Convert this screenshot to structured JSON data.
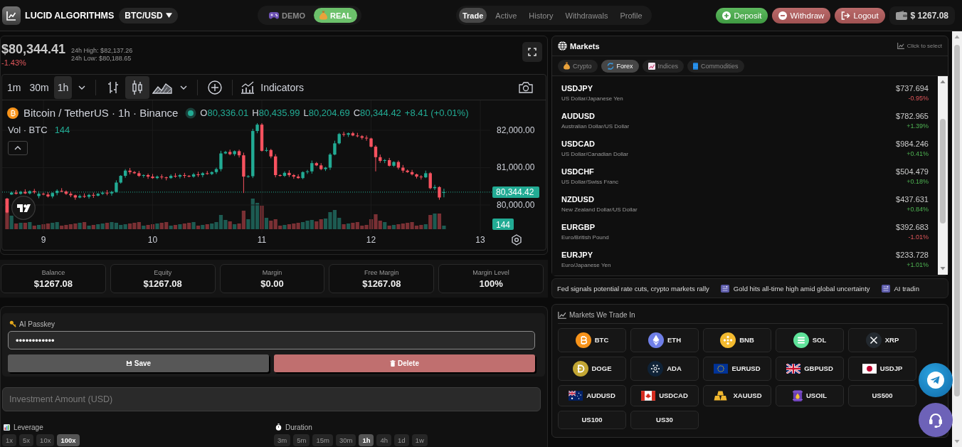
{
  "header": {
    "brand": "LUCID ALGORITHMS",
    "pair": "BTC/USD",
    "modes": [
      {
        "label": "DEMO",
        "kind": "demo",
        "selected": false
      },
      {
        "label": "REAL",
        "kind": "real",
        "selected": true
      }
    ],
    "nav": [
      {
        "label": "Trade",
        "selected": true
      },
      {
        "label": "Active",
        "selected": false
      },
      {
        "label": "History",
        "selected": false
      },
      {
        "label": "Withdrawals",
        "selected": false
      },
      {
        "label": "Profile",
        "selected": false
      }
    ],
    "actions": [
      {
        "label": "Deposit",
        "kind": "deposit"
      },
      {
        "label": "Withdraw",
        "kind": "withdraw"
      },
      {
        "label": "Logout",
        "kind": "logout"
      }
    ],
    "balance": "$ 1267.08"
  },
  "price_summary": {
    "price": "$80,344.41",
    "change": "-1.43%",
    "rising": false,
    "high": "24h High: $82,137.26",
    "low": "24h Low: $80,188.65"
  },
  "chart_widget": {
    "intervals": [
      {
        "label": "1m",
        "selected": false
      },
      {
        "label": "30m",
        "selected": false
      },
      {
        "label": "1h",
        "selected": true
      }
    ],
    "styles": [
      {
        "kind": "bars",
        "selected": false
      },
      {
        "kind": "candles",
        "selected": true
      },
      {
        "kind": "area",
        "selected": false
      }
    ],
    "indicators": "Indicators",
    "symbol": "Bitcoin / TetherUS · 1h · Binance",
    "ohlc": [
      {
        "label": "O",
        "value": "80,336.01"
      },
      {
        "label": "H",
        "value": "80,435.99"
      },
      {
        "label": "L",
        "value": "80,204.69"
      },
      {
        "label": "C",
        "value": "80,344.42"
      }
    ],
    "change": "+8.41 (+0.01%)",
    "volume_label": "Vol · BTC",
    "volume_value": "144",
    "last_volume": "144",
    "chart_data": {
      "type": "candlestick",
      "x": [
        8.667,
        8.708,
        8.75,
        8.792,
        8.833,
        8.875,
        8.917,
        8.958,
        9,
        9.042,
        9.083,
        9.125,
        9.167,
        9.208,
        9.25,
        9.292,
        9.333,
        9.375,
        9.417,
        9.458,
        9.5,
        9.542,
        9.583,
        9.625,
        9.667,
        9.708,
        9.75,
        9.792,
        9.833,
        9.875,
        9.917,
        9.958,
        10,
        10.042,
        10.083,
        10.125,
        10.167,
        10.208,
        10.25,
        10.292,
        10.333,
        10.375,
        10.417,
        10.458,
        10.5,
        10.542,
        10.583,
        10.625,
        10.667,
        10.708,
        10.75,
        10.792,
        10.833,
        10.875,
        10.917,
        10.958,
        11,
        11.042,
        11.083,
        11.125,
        11.167,
        11.208,
        11.25,
        11.292,
        11.333,
        11.375,
        11.417,
        11.458,
        11.5,
        11.542,
        11.583,
        11.625,
        11.667,
        11.708,
        11.75,
        11.792,
        11.833,
        11.875,
        11.917,
        11.958,
        12,
        12.042,
        12.083,
        12.125,
        12.167,
        12.208,
        12.25,
        12.292,
        12.333,
        12.375,
        12.417,
        12.458,
        12.5,
        12.542,
        12.583,
        12.625,
        12.667
      ],
      "ohlc": [
        [
          80170,
          80190,
          79780,
          79800
        ],
        [
          80280,
          80360,
          80270,
          80330
        ],
        [
          80330,
          80400,
          80280,
          80300
        ],
        [
          80300,
          80380,
          80275,
          80350
        ],
        [
          80350,
          80420,
          80290,
          80310
        ],
        [
          80310,
          80390,
          80280,
          80370
        ],
        [
          80370,
          80430,
          80300,
          80340
        ],
        [
          80240,
          80370,
          80180,
          80300
        ],
        [
          80300,
          80330,
          80260,
          80280
        ],
        [
          80280,
          80340,
          80200,
          80230
        ],
        [
          80230,
          80340,
          80180,
          80320
        ],
        [
          80320,
          80420,
          80260,
          80380
        ],
        [
          80380,
          80450,
          80340,
          80360
        ],
        [
          80360,
          80390,
          80270,
          80300
        ],
        [
          80300,
          80360,
          80210,
          80260
        ],
        [
          80260,
          80280,
          80140,
          80200
        ],
        [
          80200,
          80280,
          80180,
          80240
        ],
        [
          80240,
          80310,
          80190,
          80220
        ],
        [
          80220,
          80300,
          80170,
          80270
        ],
        [
          80270,
          80330,
          80190,
          80250
        ],
        [
          80250,
          80320,
          80230,
          80300
        ],
        [
          80300,
          80370,
          80270,
          80330
        ],
        [
          80330,
          80400,
          80260,
          80310
        ],
        [
          80310,
          80380,
          80250,
          80350
        ],
        [
          80350,
          80660,
          80330,
          80600
        ],
        [
          80600,
          80800,
          80570,
          80780
        ],
        [
          80780,
          80960,
          80730,
          80920
        ],
        [
          80920,
          80990,
          80820,
          80880
        ],
        [
          80880,
          80910,
          80830,
          80850
        ],
        [
          80850,
          80910,
          80750,
          80780
        ],
        [
          80780,
          80820,
          80730,
          80800
        ],
        [
          80800,
          80840,
          80700,
          80760
        ],
        [
          80760,
          80830,
          80700,
          80720
        ],
        [
          80720,
          80790,
          80690,
          80760
        ],
        [
          80760,
          80820,
          80690,
          80740
        ],
        [
          80740,
          80760,
          80660,
          80720
        ],
        [
          80720,
          80820,
          80700,
          80780
        ],
        [
          80780,
          80850,
          80730,
          80760
        ],
        [
          80760,
          80830,
          80710,
          80800
        ],
        [
          80800,
          80860,
          80720,
          80780
        ],
        [
          80780,
          80800,
          80740,
          80760
        ],
        [
          80760,
          80860,
          80730,
          80820
        ],
        [
          80820,
          80890,
          80750,
          80800
        ],
        [
          80800,
          80880,
          80740,
          80850
        ],
        [
          80850,
          80910,
          80810,
          80830
        ],
        [
          80830,
          80900,
          80800,
          80880
        ],
        [
          80880,
          81000,
          80830,
          80960
        ],
        [
          80960,
          81450,
          80900,
          81380
        ],
        [
          81380,
          81450,
          81360,
          81420
        ],
        [
          81420,
          81480,
          81330,
          81360
        ],
        [
          81360,
          81460,
          81310,
          81440
        ],
        [
          81440,
          81480,
          81270,
          81330
        ],
        [
          81330,
          81400,
          80320,
          80760
        ],
        [
          80760,
          80800,
          80730,
          80770
        ],
        [
          80770,
          82040,
          80720,
          81980
        ],
        [
          81980,
          82190,
          81920,
          82150
        ],
        [
          82150,
          82190,
          81430,
          81450
        ],
        [
          81450,
          81540,
          81420,
          81470
        ],
        [
          81470,
          81500,
          81250,
          81300
        ],
        [
          81300,
          81360,
          80740,
          80800
        ],
        [
          80800,
          80820,
          80760,
          80780
        ],
        [
          80780,
          80900,
          80750,
          80860
        ],
        [
          80860,
          80930,
          80750,
          80800
        ],
        [
          80800,
          80830,
          80700,
          80760
        ],
        [
          80760,
          80820,
          80700,
          80720
        ],
        [
          80720,
          80900,
          80690,
          80880
        ],
        [
          80880,
          80940,
          80830,
          80900
        ],
        [
          80900,
          81190,
          80840,
          81120
        ],
        [
          81120,
          81150,
          81040,
          81060
        ],
        [
          81060,
          81120,
          80930,
          80960
        ],
        [
          80960,
          81020,
          80910,
          81000
        ],
        [
          81000,
          81390,
          80940,
          81350
        ],
        [
          81350,
          81720,
          81330,
          81650
        ],
        [
          81650,
          81930,
          81620,
          81900
        ],
        [
          81900,
          81960,
          81830,
          81880
        ],
        [
          81880,
          81940,
          81820,
          81920
        ],
        [
          81920,
          81960,
          81840,
          81860
        ],
        [
          81860,
          81930,
          81810,
          81840
        ],
        [
          81840,
          81870,
          81750,
          81800
        ],
        [
          81800,
          81860,
          81720,
          81780
        ],
        [
          81780,
          81800,
          81540,
          81560
        ],
        [
          81560,
          81600,
          80900,
          81280
        ],
        [
          81280,
          81350,
          81130,
          81180
        ],
        [
          81180,
          81230,
          81120,
          81200
        ],
        [
          81200,
          81260,
          81030,
          81050
        ],
        [
          81050,
          81170,
          81020,
          81150
        ],
        [
          81150,
          81190,
          80950,
          81000
        ],
        [
          81000,
          81070,
          80860,
          80920
        ],
        [
          80920,
          80950,
          80860,
          80880
        ],
        [
          80880,
          80940,
          80790,
          80820
        ],
        [
          80820,
          80840,
          80710,
          80760
        ],
        [
          80760,
          80800,
          80680,
          80740
        ],
        [
          80740,
          80920,
          80720,
          80850
        ],
        [
          80850,
          80880,
          80420,
          80450
        ],
        [
          80450,
          80540,
          80400,
          80480
        ],
        [
          80480,
          80500,
          80140,
          80200
        ],
        [
          80336.01,
          80435.99,
          80204.69,
          80344.42
        ]
      ],
      "xlim": [
        8.622,
        13.104
      ],
      "ylim": [
        79257,
        82800
      ],
      "grid": true,
      "xticks": [
        9,
        10,
        11,
        12,
        13
      ],
      "yticks": [
        {
          "value": 82000,
          "label": "82,000.00"
        },
        {
          "value": 81000,
          "label": "81,000.00"
        },
        {
          "value": 80000,
          "label": "80,000.00"
        }
      ],
      "ref_lines": [
        {
          "axis": "y",
          "value": 80344.42,
          "label": "80,344.42"
        }
      ]
    }
  },
  "stats": [
    {
      "label": "Balance",
      "value": "$1267.08"
    },
    {
      "label": "Equity",
      "value": "$1267.08"
    },
    {
      "label": "Margin",
      "value": "$0.00"
    },
    {
      "label": "Free Margin",
      "value": "$1267.08"
    },
    {
      "label": "Margin Level",
      "value": "100%"
    }
  ],
  "passkey": {
    "label": "AI Passkey",
    "value": "••••••••••••",
    "buttons": [
      {
        "label": "Save",
        "kind": "save"
      },
      {
        "label": "Delete",
        "kind": "delete"
      }
    ]
  },
  "investment": {
    "placeholder": "Investment Amount (USD)"
  },
  "leverage": {
    "label": "Leverage",
    "options": [
      {
        "label": "1x",
        "selected": false
      },
      {
        "label": "5x",
        "selected": false
      },
      {
        "label": "10x",
        "selected": false
      },
      {
        "label": "100x",
        "selected": true
      }
    ]
  },
  "duration": {
    "label": "Duration",
    "options": [
      {
        "label": "3m",
        "selected": false
      },
      {
        "label": "5m",
        "selected": false
      },
      {
        "label": "15m",
        "selected": false
      },
      {
        "label": "30m",
        "selected": false
      },
      {
        "label": "1h",
        "selected": true
      },
      {
        "label": "4h",
        "selected": false
      },
      {
        "label": "1d",
        "selected": false
      },
      {
        "label": "1w",
        "selected": false
      }
    ]
  },
  "markets": {
    "title": "Markets",
    "hint": "Click to select",
    "tabs": [
      {
        "label": "Crypto",
        "kind": "crypto",
        "selected": false
      },
      {
        "label": "Forex",
        "kind": "forex",
        "selected": true
      },
      {
        "label": "Indices",
        "kind": "indices",
        "selected": false
      },
      {
        "label": "Commodities",
        "kind": "commodities",
        "selected": false
      }
    ],
    "rows": [
      {
        "symbol": "USDJPY",
        "name": "US Dollar/Japanese Yen",
        "price": "$737.694",
        "change": "-0.95%",
        "rising": false
      },
      {
        "symbol": "AUDUSD",
        "name": "Australian Dollar/US Dollar",
        "price": "$782.965",
        "change": "+1.39%",
        "rising": true
      },
      {
        "symbol": "USDCAD",
        "name": "US Dollar/Canadian Dollar",
        "price": "$984.246",
        "change": "+0.41%",
        "rising": true
      },
      {
        "symbol": "USDCHF",
        "name": "US Dollar/Swiss Franc",
        "price": "$504.479",
        "change": "+0.18%",
        "rising": true
      },
      {
        "symbol": "NZDUSD",
        "name": "New Zealand Dollar/US Dollar",
        "price": "$437.631",
        "change": "+0.84%",
        "rising": true
      },
      {
        "symbol": "EURGBP",
        "name": "Euro/British Pound",
        "price": "$392.683",
        "change": "-1.01%",
        "rising": false
      },
      {
        "symbol": "EURJPY",
        "name": "Euro/Japanese Yen",
        "price": "$233.728",
        "change": "+1.01%",
        "rising": true
      }
    ]
  },
  "news": [
    {
      "text": "Fed signals potential rate cuts, crypto markets rally",
      "icon": false
    },
    {
      "text": "Gold hits all-time high amid global uncertainty",
      "icon": true
    },
    {
      "text": "AI tradin",
      "icon": true
    }
  ],
  "markets_we_trade": {
    "title": "Markets We Trade In",
    "items": [
      {
        "symbol": "BTC",
        "kind": "btc"
      },
      {
        "symbol": "ETH",
        "kind": "eth"
      },
      {
        "symbol": "BNB",
        "kind": "bnb"
      },
      {
        "symbol": "SOL",
        "kind": "sol"
      },
      {
        "symbol": "XRP",
        "kind": "xrp"
      },
      {
        "symbol": "DOGE",
        "kind": "doge"
      },
      {
        "symbol": "ADA",
        "kind": "ada"
      },
      {
        "symbol": "EURUSD",
        "kind": "eu"
      },
      {
        "symbol": "GBPUSD",
        "kind": "gb"
      },
      {
        "symbol": "USDJP",
        "kind": "jp"
      },
      {
        "symbol": "AUDUSD",
        "kind": "au"
      },
      {
        "symbol": "USDCAD",
        "kind": "ca"
      },
      {
        "symbol": "XAUUSD",
        "kind": "gold"
      },
      {
        "symbol": "USOIL",
        "kind": "oil"
      },
      {
        "symbol": "US500",
        "kind": "index"
      },
      {
        "symbol": "US100",
        "kind": "index"
      },
      {
        "symbol": "US30",
        "kind": "index"
      }
    ]
  }
}
